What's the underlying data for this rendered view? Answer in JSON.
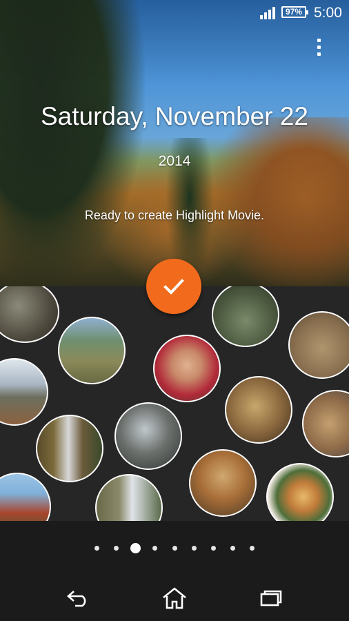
{
  "status_bar": {
    "battery_percent": "97%",
    "time": "5:00",
    "icons": [
      "signal-icon",
      "battery-icon"
    ]
  },
  "header": {
    "menu_icon": "overflow-menu-icon",
    "date_title": "Saturday, November 22",
    "year": "2014",
    "message": "Ready to create Highlight Movie."
  },
  "action": {
    "icon": "checkmark-icon",
    "color": "#f26b1d"
  },
  "photos": [
    {
      "name": "photo-rock-cave"
    },
    {
      "name": "photo-family-trail"
    },
    {
      "name": "photo-forest-floor"
    },
    {
      "name": "photo-hiker-mountain"
    },
    {
      "name": "photo-boy-selfie"
    },
    {
      "name": "photo-mountain-view"
    },
    {
      "name": "photo-grilled-fish"
    },
    {
      "name": "photo-fish-rack"
    },
    {
      "name": "photo-waterfall"
    },
    {
      "name": "photo-stream-rocks"
    },
    {
      "name": "photo-autumn-trees"
    },
    {
      "name": "photo-noodle-bowl"
    },
    {
      "name": "photo-autumn-valley"
    },
    {
      "name": "photo-river-cascade"
    }
  ],
  "pager": {
    "total": 9,
    "active_index": 2
  },
  "navbar": {
    "icons": [
      "back-icon",
      "home-icon",
      "recent-apps-icon"
    ]
  },
  "colors": {
    "accent": "#f26b1d",
    "background": "#262626"
  }
}
